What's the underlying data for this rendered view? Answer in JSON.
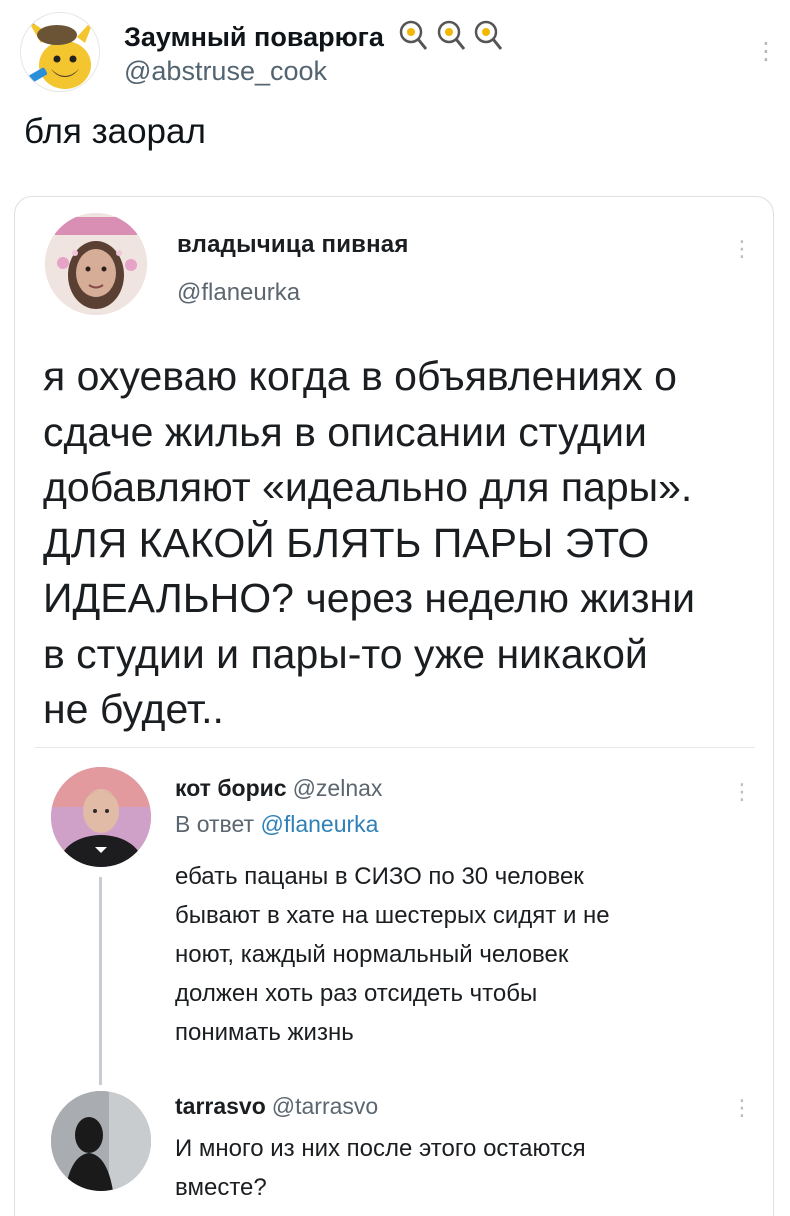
{
  "tweet": {
    "author": {
      "name": "Заумный поварюга",
      "handle": "@abstruse_cook",
      "name_emoji_icons": [
        "frying-pan-icon",
        "frying-pan-icon",
        "frying-pan-icon"
      ]
    },
    "text": "бля заорал"
  },
  "quoted": {
    "author": {
      "name": "владычица пивная",
      "handle": "@flaneurka"
    },
    "text_lines": [
      "я охуеваю когда в объявлениях о",
      "сдаче жилья в описании студии",
      "добавляют «идеально для пары».",
      "ДЛЯ КАКОЙ БЛЯТЬ ПАРЫ ЭТО",
      "ИДЕАЛЬНО? через неделю жизни",
      "в студии и пары-то уже никакой",
      "не будет.."
    ]
  },
  "replies": [
    {
      "name": "кот борис",
      "handle": "@zelnax",
      "reply_to_prefix": "В ответ",
      "reply_to_handle": "@flaneurka",
      "text_lines": [
        "ебать пацаны в СИЗО по 30 человек",
        "бывают в хате на шестерых сидят и не",
        "ноют, каждый нормальный человек",
        "должен хоть раз отсидеть чтобы",
        "понимать жизнь"
      ]
    },
    {
      "name": "tarrasvo",
      "handle": "@tarrasvo",
      "text_lines": [
        "И много из них после этого остаются",
        "вместе?"
      ]
    }
  ],
  "icons": {
    "more": "more-vertical-icon"
  },
  "colors": {
    "text": "#0f1419",
    "secondary": "#536471",
    "link": "#2f80b8",
    "border": "#dcdfe3"
  }
}
